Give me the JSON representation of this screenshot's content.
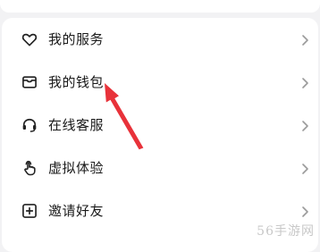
{
  "menu": {
    "items": [
      {
        "label": "我的服务",
        "icon": "heart-icon"
      },
      {
        "label": "我的钱包",
        "icon": "wallet-icon"
      },
      {
        "label": "在线客服",
        "icon": "headset-icon"
      },
      {
        "label": "虚拟体验",
        "icon": "touch-hand-icon"
      },
      {
        "label": "邀请好友",
        "icon": "plus-square-icon"
      }
    ]
  },
  "annotation": {
    "color": "#e8323a"
  },
  "watermark": "56手游网"
}
